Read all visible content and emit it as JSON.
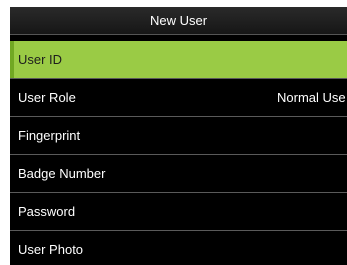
{
  "header": {
    "title": "New User"
  },
  "menu": {
    "items": [
      {
        "label": "User ID",
        "value": ""
      },
      {
        "label": "User Role",
        "value": "Normal Use"
      },
      {
        "label": "Fingerprint",
        "value": ""
      },
      {
        "label": "Badge Number",
        "value": ""
      },
      {
        "label": "Password",
        "value": ""
      },
      {
        "label": "User Photo",
        "value": ""
      }
    ],
    "selected_index": 0
  },
  "colors": {
    "background": "#000000",
    "selected_row": "#9acb45",
    "text": "#ffffff",
    "divider": "#5a5a5a"
  }
}
